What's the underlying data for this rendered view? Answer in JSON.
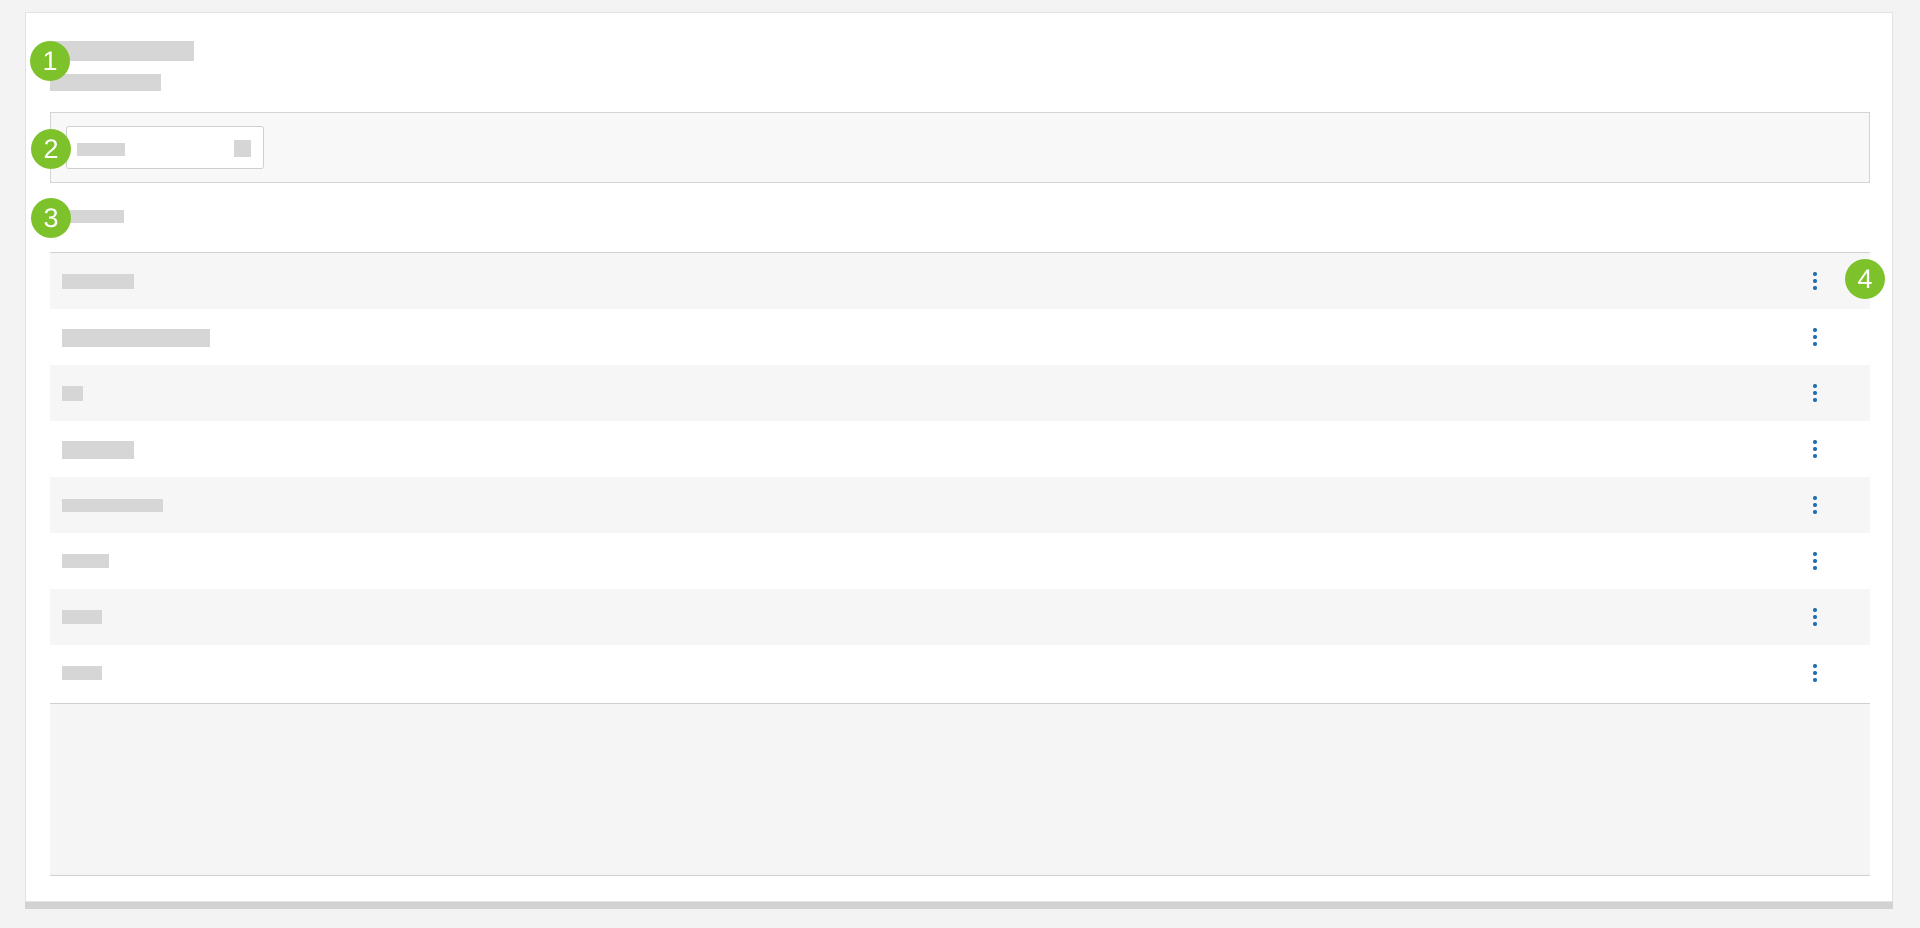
{
  "colors": {
    "accent": "#1f6fb2",
    "badge": "#7dc12b",
    "placeholder": "#d6d6d6"
  },
  "badges": [
    "1",
    "2",
    "3",
    "4"
  ],
  "table": {
    "rows": [
      {
        "id": 1,
        "action_icon": "kebab-menu-icon"
      },
      {
        "id": 2,
        "action_icon": "kebab-menu-icon"
      },
      {
        "id": 3,
        "action_icon": "kebab-menu-icon"
      },
      {
        "id": 4,
        "action_icon": "kebab-menu-icon"
      },
      {
        "id": 5,
        "action_icon": "kebab-menu-icon"
      },
      {
        "id": 6,
        "action_icon": "kebab-menu-icon"
      },
      {
        "id": 7,
        "action_icon": "kebab-menu-icon"
      },
      {
        "id": 8,
        "action_icon": "kebab-menu-icon"
      }
    ]
  }
}
